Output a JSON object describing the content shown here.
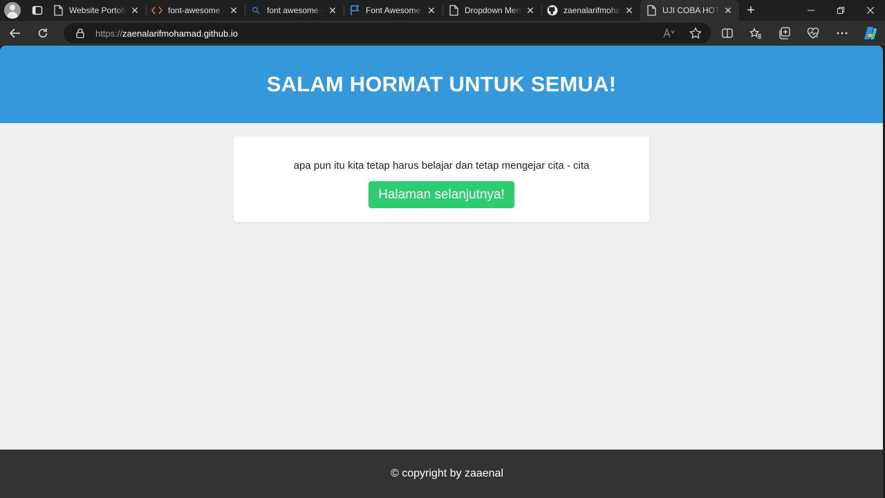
{
  "browser": {
    "tabs": [
      {
        "label": "Website Portofolio",
        "icon": "page-icon",
        "active": false
      },
      {
        "label": "font-awesome - CDN",
        "icon": "code-icon",
        "active": false
      },
      {
        "label": "font awesome - Search",
        "icon": "search-icon",
        "active": false
      },
      {
        "label": "Font Awesome",
        "icon": "flag-icon",
        "active": false
      },
      {
        "label": "Dropdown Menu",
        "icon": "page-icon",
        "active": false
      },
      {
        "label": "zaenalarifmohamad",
        "icon": "github-icon",
        "active": false
      },
      {
        "label": "UJI COBA HOTING",
        "icon": "page-icon",
        "active": true
      }
    ],
    "address": {
      "scheme": "https://",
      "host": "zaenalarifmohamad.github.io"
    }
  },
  "page": {
    "header_title": "SALAM HORMAT UNTUK SEMUA!",
    "message": "apa pun itu kita tetap harus belajar dan tetap mengejar cita - cita",
    "button_label": "Halaman selanjutnya!",
    "footer_text": "© copyright by zaaenal"
  },
  "colors": {
    "header_bg": "#3498db",
    "button_bg": "#2ecc71",
    "footer_bg": "#333333",
    "page_bg": "#efefef"
  }
}
